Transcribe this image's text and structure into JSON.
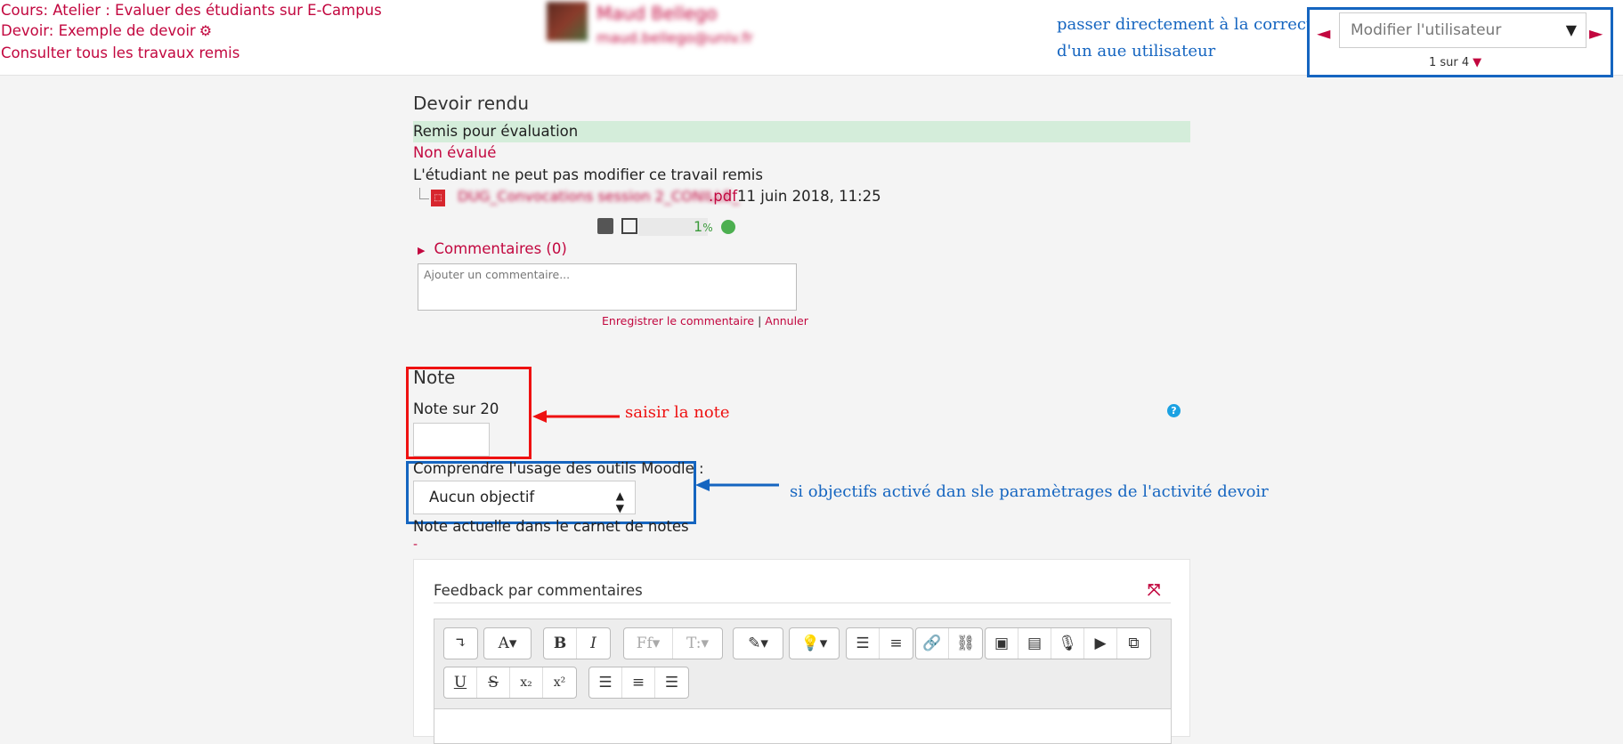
{
  "header": {
    "course_link": "Cours: Atelier : Evaluer des étudiants sur E-Campus",
    "assignment_link": "Devoir: Exemple de devoir",
    "view_all_link": "Consulter tous les travaux remis",
    "user_name": "Maud Bellego",
    "user_email": "maud.bellego@univ.fr",
    "annotation_line1": "passer directement à la correction",
    "annotation_line2": "d'un aue utilisateur",
    "user_selector_placeholder": "Modifier l'utilisateur",
    "user_count": "1 sur 4"
  },
  "submission": {
    "title": "Devoir rendu",
    "status": "Remis pour évaluation",
    "grading_status": "Non évalué",
    "lock_note": "L'étudiant ne peut pas modifier ce travail remis",
    "file_name": "DUG_Convocations session 2_CONILLE_",
    "file_ext": ".pdf",
    "file_date": "11 juin 2018, 11:25",
    "plagiarism_score": "1",
    "plagiarism_unit": "%",
    "comments_label": "Commentaires (0)",
    "comment_placeholder": "Ajouter un commentaire...",
    "save_comment": "Enregistrer le commentaire",
    "separator": "|",
    "cancel": "Annuler"
  },
  "grade": {
    "title": "Note",
    "label": "Note sur 20",
    "annotation": "saisir la note",
    "outcome_label": "Comprendre l'usage des outils Moodle :",
    "outcome_value": "Aucun objectif",
    "outcome_annotation": "si objectifs activé dan sle paramètrages de l'activité devoir",
    "gradebook_label": "Note actuelle dans le carnet de notes",
    "gradebook_value": "-"
  },
  "feedback": {
    "title": "Feedback par commentaires"
  },
  "colors": {
    "accent": "#c2073f",
    "annotation_blue": "#1565c0",
    "annotation_red": "#e11111",
    "status_green": "#d4edda"
  }
}
